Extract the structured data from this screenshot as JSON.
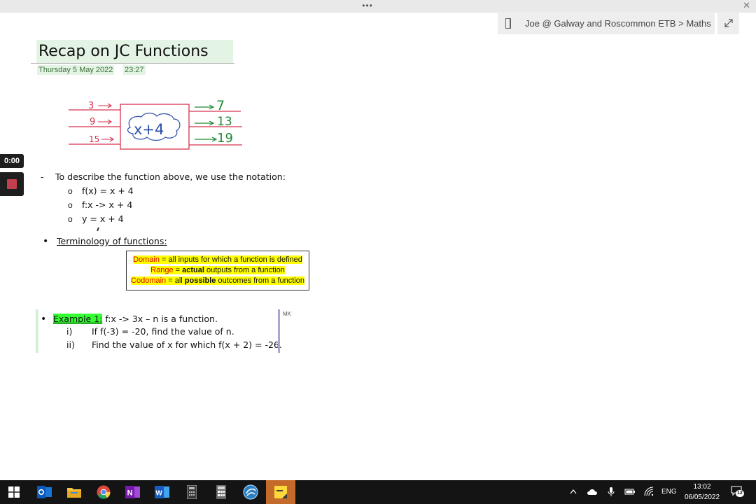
{
  "window": {
    "drag_handle": "•••"
  },
  "notebook": {
    "path": "Joe @ Galway and Roscommon ETB > Maths"
  },
  "page": {
    "title": "Recap on JC Functions",
    "date": "Thursday 5 May 2022",
    "time": "23:27"
  },
  "diagram": {
    "inputs": [
      "3",
      "9",
      "15"
    ],
    "function": "x+4",
    "outputs": [
      "7",
      "13",
      "19"
    ],
    "input_color": "#d6334f",
    "output_color": "#1e8a34",
    "bubble_color": "#2c4ea8"
  },
  "recording": {
    "elapsed": "0:00"
  },
  "notes": {
    "dash": "-",
    "notation_intro": "To describe the function above, we use the notation:",
    "sub_bullet": "o",
    "notations": [
      "f(x) = x + 4",
      "f:x -> x + 4",
      "y = x + 4"
    ],
    "bullet": "•",
    "terminology_heading": "Terminology of functions:"
  },
  "definitions": {
    "domain_term": "Domain",
    "domain_eq": " = ",
    "domain_text": "all inputs for which a function is defined",
    "range_term": "Range",
    "range_eq": " = ",
    "range_bold": "actual",
    "range_text": " outputs from a function",
    "codomain_term": "Codomain",
    "codomain_eq": " = all ",
    "codomain_bold": "possible",
    "codomain_text": " outcomes from a function"
  },
  "example": {
    "label": "Example 1:",
    "statement": " f:x -> 3x – n is a function.",
    "parts": [
      {
        "label": "i)",
        "text": "If f(-3) = -20, find the value of n."
      },
      {
        "label": "ii)",
        "text": "Find the value of x for which f(x + 2) = -26."
      }
    ],
    "author": "MK"
  },
  "taskbar": {
    "apps": [
      "windows-start",
      "outlook",
      "file-explorer",
      "chrome",
      "onenote",
      "word",
      "calculator-dark",
      "calculator",
      "connect",
      "sticky-notes"
    ],
    "active_app": "sticky-notes",
    "language": "ENG",
    "time": "13:02",
    "date": "06/05/2022",
    "notifications": "12",
    "accent_color": "#c46a2a"
  }
}
